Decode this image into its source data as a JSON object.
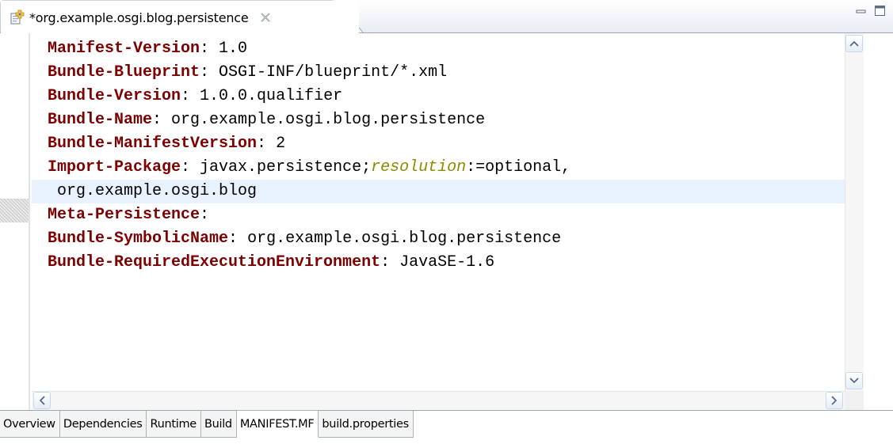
{
  "editor": {
    "tab_title": "*org.example.osgi.blog.persistence",
    "tab_icon": "plugin-manifest-icon",
    "dirty": true,
    "minimize_icon": "minimize-icon",
    "maximize_icon": "maximize-icon"
  },
  "manifest_lines": [
    {
      "header": "Manifest-Version",
      "sep": ": ",
      "value": "1.0"
    },
    {
      "header": "Bundle-Blueprint",
      "sep": ": ",
      "value": "OSGI-INF/blueprint/*.xml"
    },
    {
      "header": "Bundle-Version",
      "sep": ": ",
      "value": "1.0.0.qualifier"
    },
    {
      "header": "Bundle-Name",
      "sep": ": ",
      "value": "org.example.osgi.blog.persistence"
    },
    {
      "header": "Bundle-ManifestVersion",
      "sep": ": ",
      "value": "2"
    },
    {
      "header": "Import-Package",
      "sep": ": ",
      "value_before": "javax.persistence;",
      "attribute": "resolution",
      "value_after": ":=optional,"
    },
    {
      "continuation": " org.example.osgi.blog",
      "current": true
    },
    {
      "header": "Meta-Persistence",
      "sep": ":",
      "value": ""
    },
    {
      "header": "Bundle-SymbolicName",
      "sep": ": ",
      "value": "org.example.osgi.blog.persistence"
    },
    {
      "header": "Bundle-RequiredExecutionEnvironment",
      "sep": ": ",
      "value": "JavaSE-1.6"
    }
  ],
  "page_tabs": [
    {
      "label": "Overview",
      "active": false
    },
    {
      "label": "Dependencies",
      "active": false
    },
    {
      "label": "Runtime",
      "active": false
    },
    {
      "label": "Build",
      "active": false
    },
    {
      "label": "MANIFEST.MF",
      "active": true
    },
    {
      "label": "build.properties",
      "active": false
    }
  ],
  "colors": {
    "header_key": "#7f0000",
    "attribute": "#8c8c00",
    "current_line": "#e8f2fe",
    "tab_border": "#9aa8bb"
  }
}
